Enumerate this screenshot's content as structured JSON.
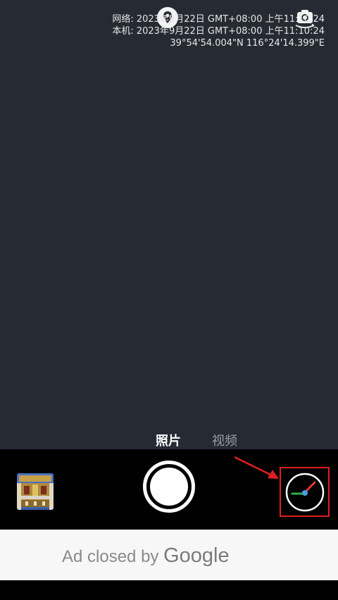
{
  "viewfinder": {
    "overlay_lines": [
      "网络: 2023年9月22日 GMT+08:00 上午11:10:24",
      "本机: 2023年9月22日 GMT+08:00 上午11:10:24",
      "39°54'54.004\"N 116°24'14.399\"E"
    ],
    "icons": {
      "location": "location-pin-icon",
      "camera_switch": "camera-switch-icon"
    }
  },
  "mode_tabs": {
    "photo": "照片",
    "video": "视频",
    "selected": "photo"
  },
  "controls": {
    "gallery_thumbnail": "gallery-thumbnail",
    "shutter": "shutter-button",
    "compass": "compass-icon"
  },
  "ad": {
    "text_prefix": "Ad closed by",
    "brand": "Google"
  },
  "colors": {
    "viewfinder_bg": "#262b33",
    "highlight": "#e02020",
    "compass_green": "#2db34a",
    "compass_red": "#e53935",
    "compass_blue": "#4a9de0"
  }
}
